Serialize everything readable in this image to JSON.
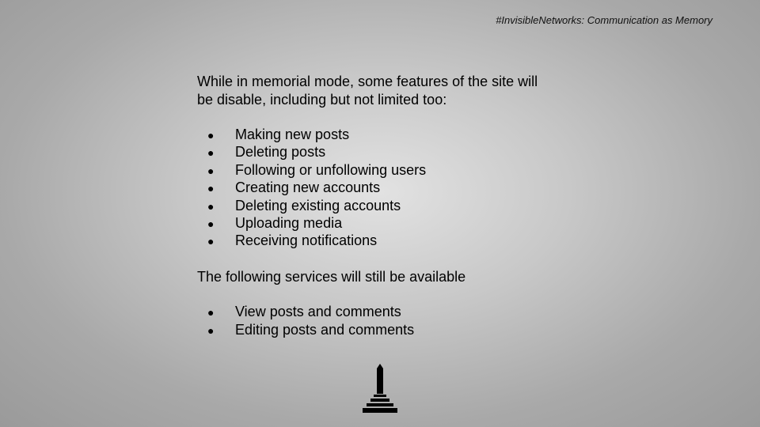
{
  "header": {
    "text": "#InvisibleNetworks: Communication as Memory"
  },
  "content": {
    "intro_line1": "While in memorial mode, some features of the site will",
    "intro_line2": "be disable, including but not limited too:",
    "bullet_char": "●",
    "disabled_features": [
      "Making new posts",
      "Deleting posts",
      "Following or unfollowing users",
      "Creating new accounts",
      "Deleting existing accounts",
      "Uploading media",
      "Receiving notifications"
    ],
    "available_heading": "The following services will still be available",
    "available_features": [
      "View posts and comments",
      "Editing posts and comments"
    ]
  },
  "icons": {
    "footer": "monument-icon"
  }
}
